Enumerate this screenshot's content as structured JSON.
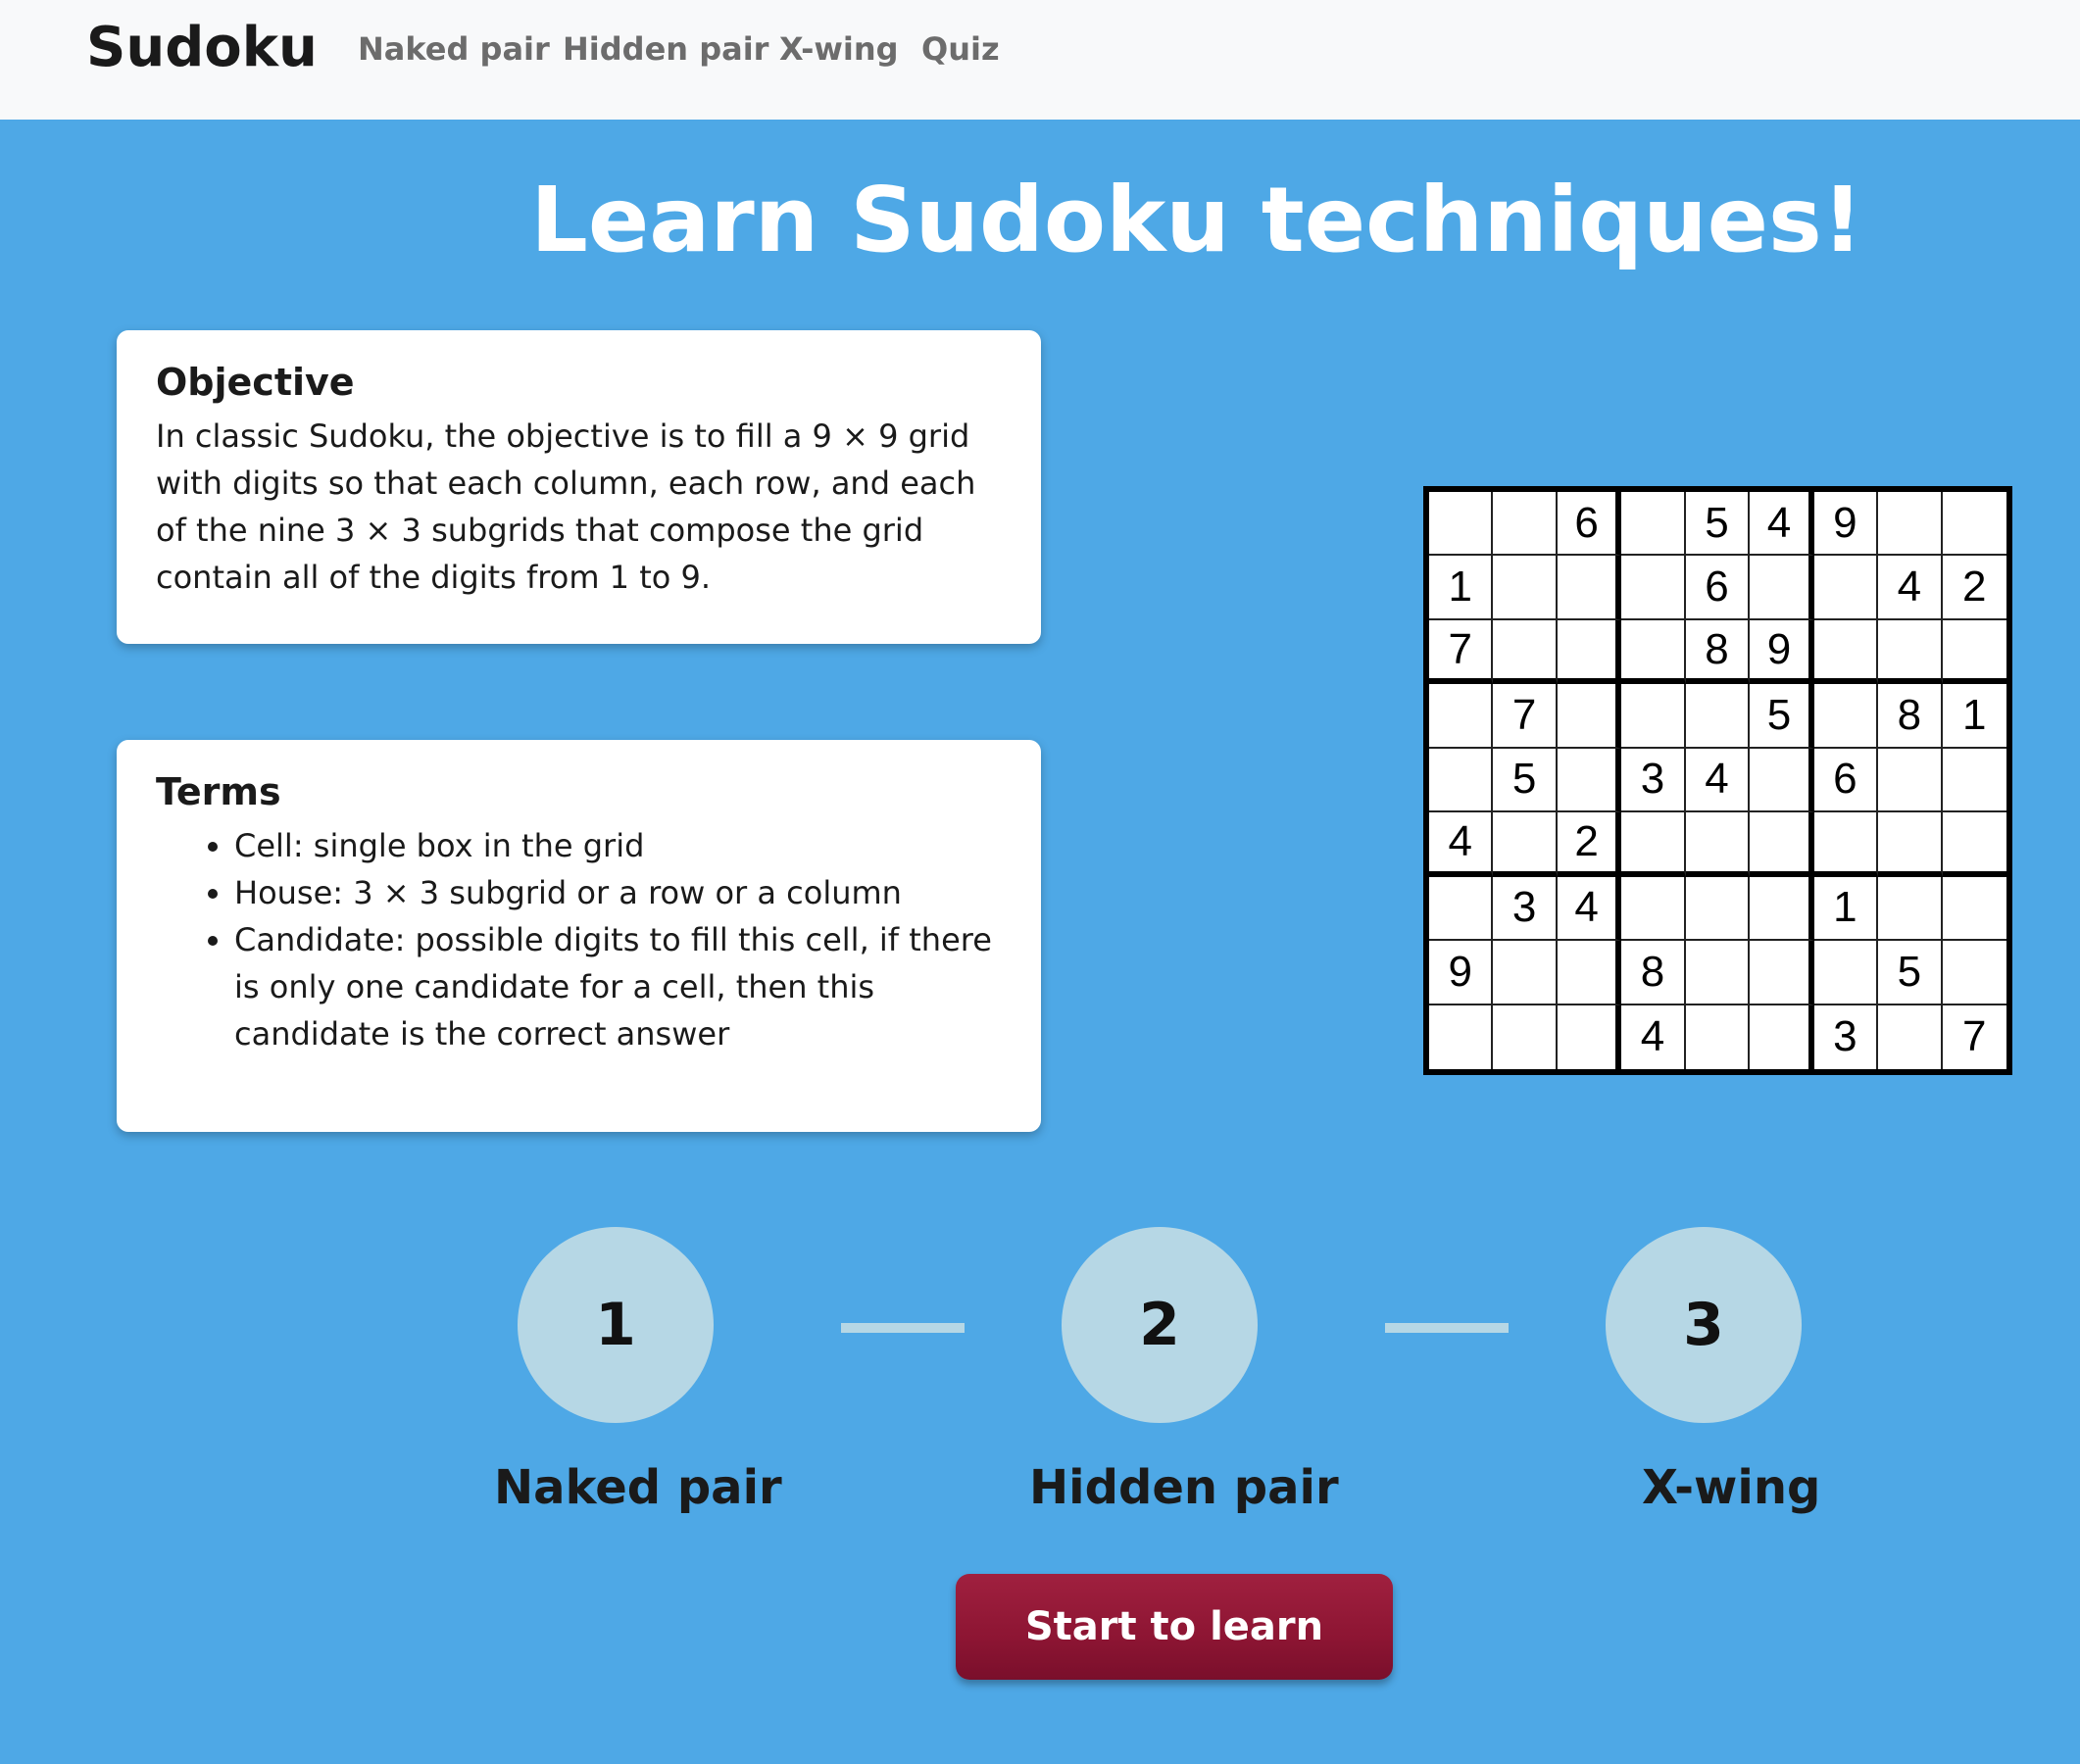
{
  "navbar": {
    "brand": "Sudoku",
    "links": [
      "Naked pair",
      "Hidden pair",
      "X-wing",
      "Quiz"
    ]
  },
  "hero": {
    "title": "Learn Sudoku techniques!"
  },
  "objective": {
    "title": "Objective",
    "text": "In classic Sudoku, the objective is to fill a 9 × 9 grid with digits so that each column, each row, and each of the nine 3 × 3 subgrids that compose the grid contain all of the digits from 1 to 9."
  },
  "terms": {
    "title": "Terms",
    "items": [
      "Cell: single box in the grid",
      "House: 3 × 3 subgrid or a row or a column",
      "Candidate: possible digits to fill this cell, if there is only one candidate for a cell, then this candidate is the correct answer"
    ]
  },
  "sudoku": {
    "rows": [
      [
        "",
        "",
        "6",
        "",
        "5",
        "4",
        "9",
        "",
        ""
      ],
      [
        "1",
        "",
        "",
        "",
        "6",
        "",
        "",
        "4",
        "2"
      ],
      [
        "7",
        "",
        "",
        "",
        "8",
        "9",
        "",
        "",
        ""
      ],
      [
        "",
        "7",
        "",
        "",
        "",
        "5",
        "",
        "8",
        "1"
      ],
      [
        "",
        "5",
        "",
        "3",
        "4",
        "",
        "6",
        "",
        ""
      ],
      [
        "4",
        "",
        "2",
        "",
        "",
        "",
        "",
        "",
        ""
      ],
      [
        "",
        "3",
        "4",
        "",
        "",
        "",
        "1",
        "",
        ""
      ],
      [
        "9",
        "",
        "",
        "8",
        "",
        "",
        "",
        "5",
        ""
      ],
      [
        "",
        "",
        "",
        "4",
        "",
        "",
        "3",
        "",
        "7"
      ]
    ]
  },
  "steps": [
    {
      "number": "1",
      "label": "Naked pair"
    },
    {
      "number": "2",
      "label": "Hidden pair"
    },
    {
      "number": "3",
      "label": "X-wing"
    }
  ],
  "cta": {
    "label": "Start to learn"
  },
  "colors": {
    "background": "#4ea8e6",
    "step_circle": "#b6d7e5",
    "button": "#8d1533"
  }
}
